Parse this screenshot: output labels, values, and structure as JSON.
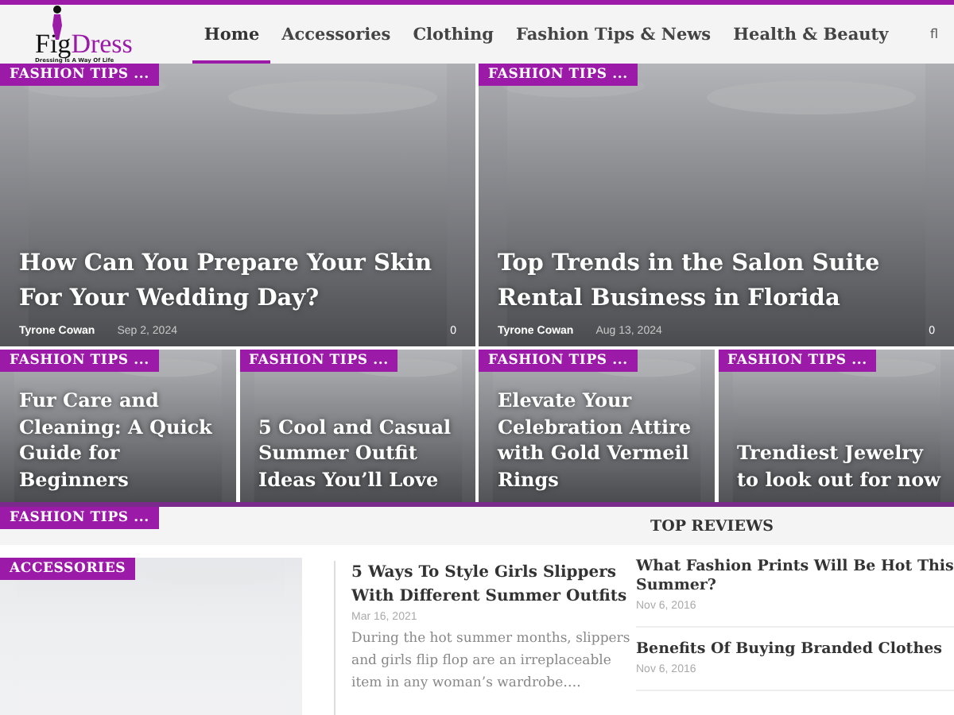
{
  "logo": {
    "name_dark": "Fig",
    "name_accent": "Dress",
    "tagline": "Dressing Is A Way Of Life"
  },
  "nav": [
    {
      "label": "Home",
      "selected": true
    },
    {
      "label": "Accessories",
      "selected": false
    },
    {
      "label": "Clothing",
      "selected": false
    },
    {
      "label": "Fashion Tips & News",
      "selected": false
    },
    {
      "label": "Health & Beauty",
      "selected": false
    }
  ],
  "search_icon": "fl",
  "featured": [
    {
      "category": "FASHION TIPS ...",
      "title": "How Can You Prepare Your Skin For Your Wedding Day?",
      "author": "Tyrone Cowan",
      "date": "Sep 2, 2024",
      "comments": "0"
    },
    {
      "category": "FASHION TIPS ...",
      "title": "Top Trends in the Salon Suite Rental Business in Florida",
      "author": "Tyrone Cowan",
      "date": "Aug 13, 2024",
      "comments": "0"
    }
  ],
  "small_cards": [
    {
      "category": "FASHION TIPS ...",
      "title": "Fur Care and Cleaning: A Quick Guide for Beginners"
    },
    {
      "category": "FASHION TIPS ...",
      "title": "5 Cool and Casual Summer Outfit Ideas You’ll Love"
    },
    {
      "category": "FASHION TIPS ...",
      "title": "Elevate Your Celebration Attire with Gold Vermeil Rings"
    },
    {
      "category": "FASHION TIPS ...",
      "title": "Trendiest Jewelry to look out for now"
    }
  ],
  "section_badge": "FASHION TIPS ...",
  "top_reviews_heading": "TOP REVIEWS",
  "accessories": {
    "category": "ACCESSORIES",
    "title": "5 Ways To Style Girls Slippers With Different Summer Outfits",
    "date": "Mar 16, 2021",
    "excerpt": "During the hot summer months, slippers and girls flip flop are an irreplaceable item in any woman’s wardrobe…."
  },
  "top_reviews": [
    {
      "title": "What Fashion Prints Will Be Hot This Summer?",
      "date": "Nov 6, 2016"
    },
    {
      "title": "Benefits Of Buying Branded Clothes",
      "date": "Nov 6, 2016"
    }
  ]
}
